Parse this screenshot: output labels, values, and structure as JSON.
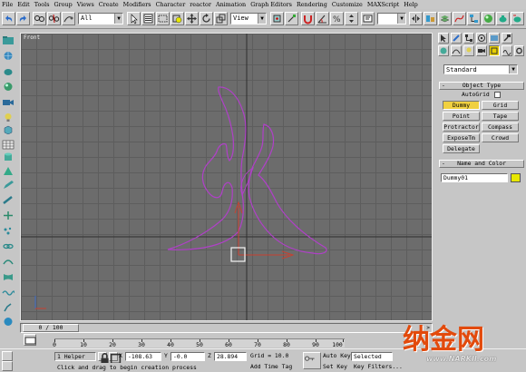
{
  "menu": [
    "File",
    "Edit",
    "Tools",
    "Group",
    "Views",
    "Create",
    "Modifiers",
    "Character",
    "reactor",
    "Animation",
    "Graph Editors",
    "Rendering",
    "Customize",
    "MAXScript",
    "Help"
  ],
  "toolbar": {
    "selection_filter": "All",
    "reference_coord": "View",
    "named_selection": ""
  },
  "viewport": {
    "label": "Front"
  },
  "command_panel": {
    "dropdown": "Standard",
    "object_type_title": "Object Type",
    "autogrid_label": "AutoGrid",
    "buttons": [
      "Dummy",
      "Grid",
      "Point",
      "Tape",
      "Protractor",
      "Compass",
      "ExposeTm",
      "Crowd",
      "Delegate"
    ],
    "active_button": "Dummy",
    "name_color_title": "Name and Color",
    "name_value": "Dummy01"
  },
  "timeline": {
    "slider_label": "0 / 100",
    "ruler_ticks": [
      "0",
      "10",
      "20",
      "30",
      "40",
      "50",
      "60",
      "70",
      "80",
      "90",
      "100"
    ]
  },
  "status": {
    "selection_count": "1 Helper",
    "x_label": "X",
    "x_value": "-108.63",
    "y_label": "Y",
    "y_value": "-0.0",
    "z_label": "Z",
    "z_value": "28.894",
    "grid": "Grid = 10.0",
    "auto_key": "Auto Key",
    "set_key": "Set Key",
    "selected_dropdown": "Selected",
    "key_filters": "Key Filters...",
    "prompt": "Click and drag to begin creation process",
    "add_time_tag": "Add Time Tag"
  },
  "watermark": {
    "text": "纳金网",
    "url": "www.NARKII.com"
  },
  "colors": {
    "viewport_bg": "#6c6c6c",
    "spline": "#b040c8",
    "gizmo": "#c84030",
    "active_button": "#f0d040",
    "watermark": "#e24a0c"
  }
}
